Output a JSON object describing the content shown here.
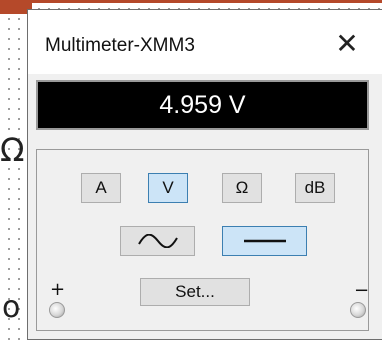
{
  "window": {
    "title": "Multimeter-XMM3",
    "close_icon": "close-icon"
  },
  "display": {
    "reading": "4.959 V"
  },
  "modes": [
    {
      "label": "A",
      "active": false
    },
    {
      "label": "V",
      "active": true
    },
    {
      "label": "Ω",
      "active": false
    },
    {
      "label": "dB",
      "active": false
    }
  ],
  "signal": {
    "ac_icon": "sine-wave-icon",
    "dc_icon": "dc-line-icon",
    "selected": "dc"
  },
  "set_button": {
    "label": "Set..."
  },
  "terminals": {
    "positive": "+",
    "negative": "−"
  },
  "background": {
    "side_glyph_top": "Ω",
    "side_glyph_bottom": "o"
  },
  "colors": {
    "active_fill": "#cce4f7",
    "active_border": "#3c7fb1",
    "display_bg": "#000000",
    "display_fg": "#ffffff",
    "strip": "#b5492a"
  }
}
